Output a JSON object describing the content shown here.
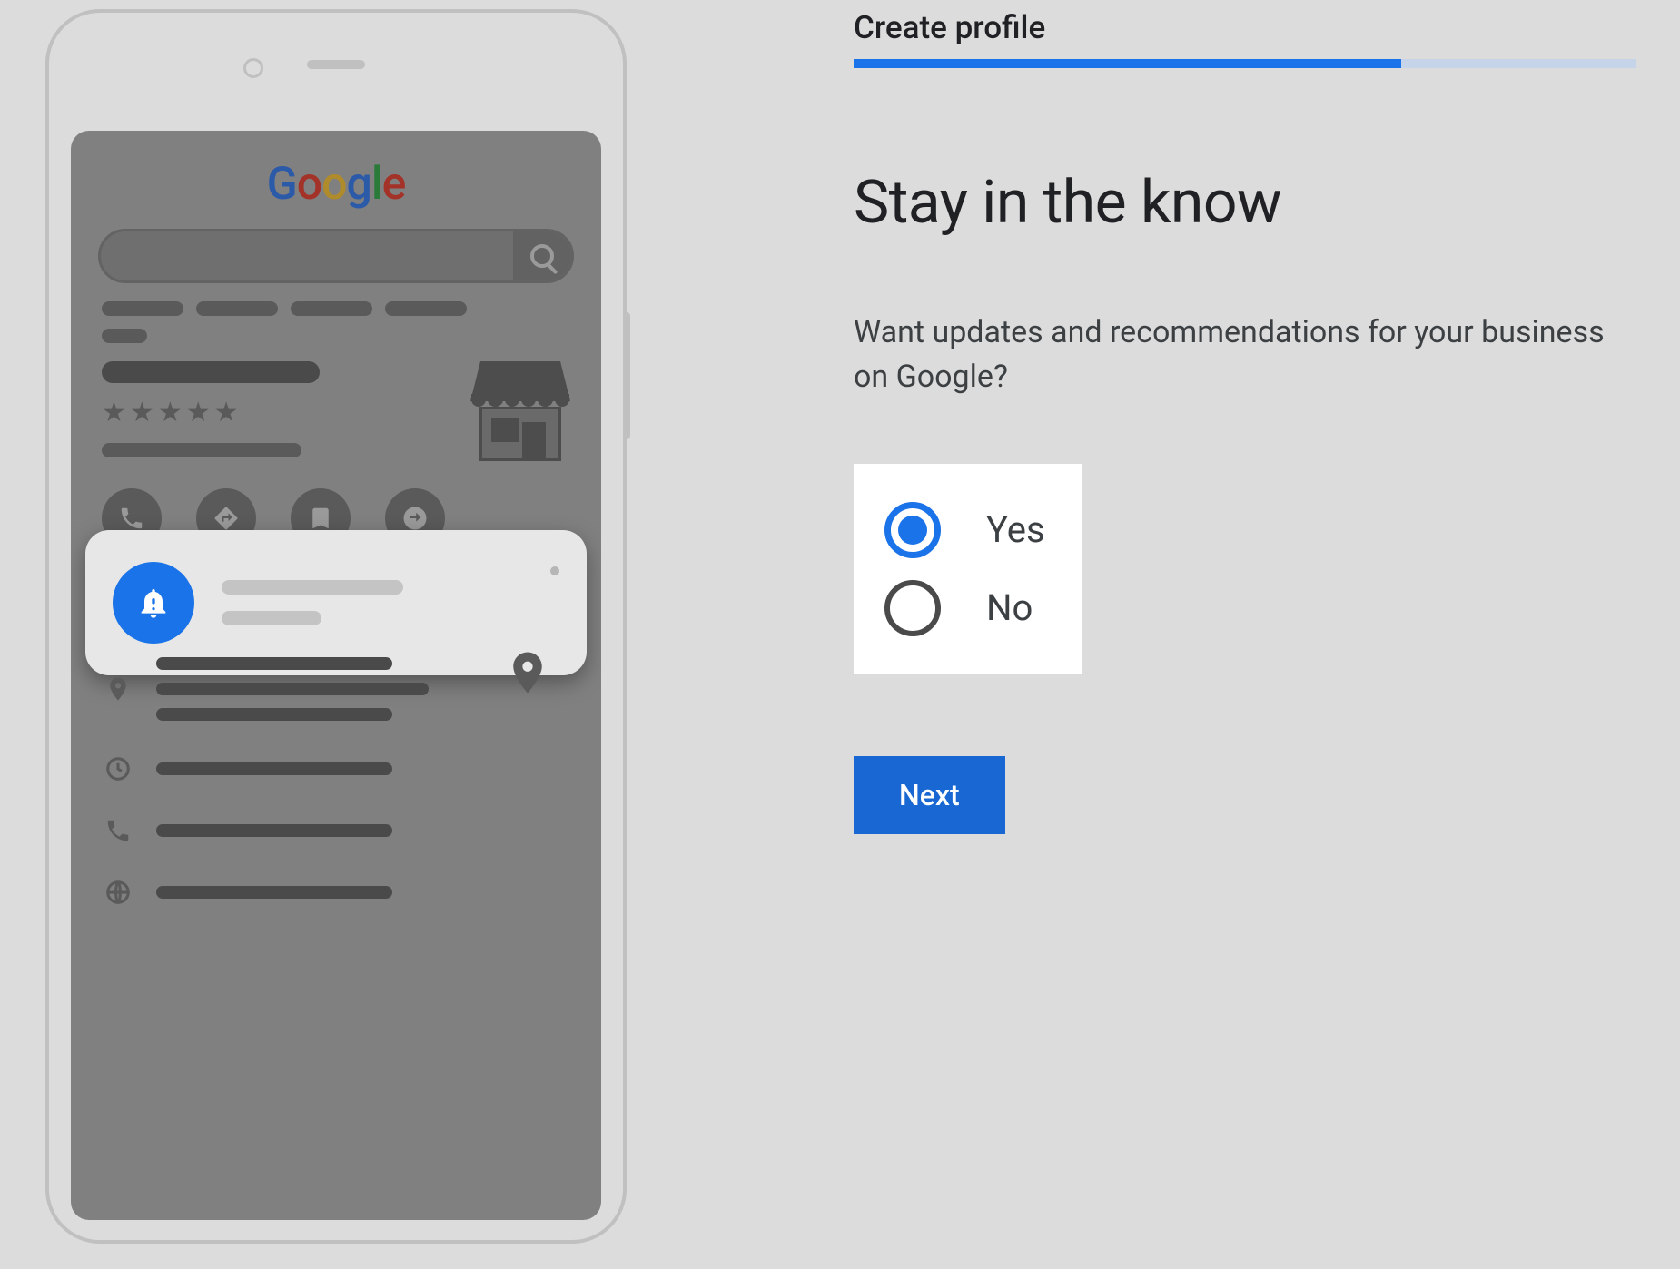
{
  "colors": {
    "accent": "#1a73e8",
    "button": "#1967d2",
    "text_primary": "#202124",
    "text_secondary": "#3c4043"
  },
  "illustration": {
    "logo_letters": [
      "G",
      "o",
      "o",
      "g",
      "l",
      "e"
    ]
  },
  "progress": {
    "step_label": "Create profile",
    "percent": 70
  },
  "main": {
    "heading": "Stay in the know",
    "question": "Want updates and recommendations for your business on Google?"
  },
  "form": {
    "options": [
      {
        "value": "yes",
        "label": "Yes",
        "selected": true
      },
      {
        "value": "no",
        "label": "No",
        "selected": false
      }
    ],
    "next_label": "Next"
  }
}
